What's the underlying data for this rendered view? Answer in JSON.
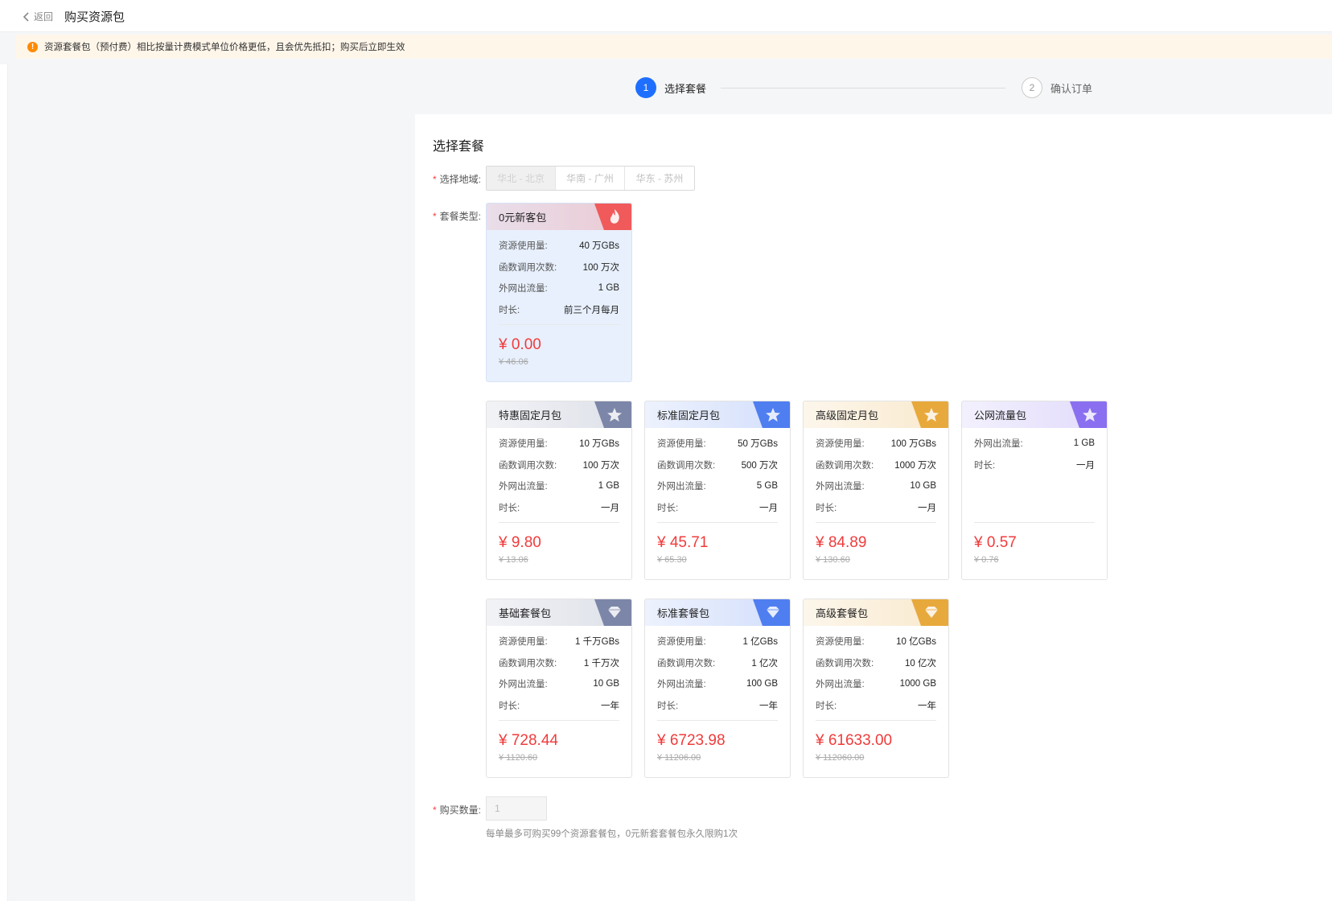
{
  "header": {
    "back_label": "返回",
    "title": "购买资源包"
  },
  "notice": {
    "text": "资源套餐包（预付费）相比按量计费模式单位价格更低，且会优先抵扣；购买后立即生效"
  },
  "steps": [
    {
      "num": "1",
      "label": "选择套餐",
      "active": true
    },
    {
      "num": "2",
      "label": "确认订单",
      "active": false
    }
  ],
  "panel": {
    "title": "选择套餐",
    "region_label": "选择地域:",
    "regions": [
      "华北 - 北京",
      "华南 - 广州",
      "华东 - 苏州"
    ],
    "selected_region": "华北 - 北京",
    "type_label": "套餐类型:",
    "quantity_label": "购买数量:",
    "quantity_value": "1",
    "hint": "每单最多可购买99个资源套餐包，0元新套套餐包永久限购1次"
  },
  "packages": [
    {
      "name": "0元新客包",
      "icon": "flame-icon",
      "accent": "#f05a5a",
      "selected": true,
      "rows": [
        {
          "k": "资源使用量:",
          "v": "40 万GBs"
        },
        {
          "k": "函数调用次数:",
          "v": "100 万次"
        },
        {
          "k": "外网出流量:",
          "v": "1 GB"
        },
        {
          "k": "时长:",
          "v": "前三个月每月"
        }
      ],
      "price": "¥ 0.00",
      "old_price": "¥ 46.06"
    },
    {
      "name": "特惠固定月包",
      "icon": "star-icon",
      "accent": "#7c86a8",
      "rows": [
        {
          "k": "资源使用量:",
          "v": "10 万GBs"
        },
        {
          "k": "函数调用次数:",
          "v": "100 万次"
        },
        {
          "k": "外网出流量:",
          "v": "1 GB"
        },
        {
          "k": "时长:",
          "v": "一月"
        }
      ],
      "price": "¥ 9.80",
      "old_price": "¥ 13.06"
    },
    {
      "name": "标准固定月包",
      "icon": "star-icon",
      "accent": "#4f7ef0",
      "rows": [
        {
          "k": "资源使用量:",
          "v": "50 万GBs"
        },
        {
          "k": "函数调用次数:",
          "v": "500 万次"
        },
        {
          "k": "外网出流量:",
          "v": "5 GB"
        },
        {
          "k": "时长:",
          "v": "一月"
        }
      ],
      "price": "¥ 45.71",
      "old_price": "¥ 65.30"
    },
    {
      "name": "高级固定月包",
      "icon": "star-icon",
      "accent": "#e8a93c",
      "rows": [
        {
          "k": "资源使用量:",
          "v": "100 万GBs"
        },
        {
          "k": "函数调用次数:",
          "v": "1000 万次"
        },
        {
          "k": "外网出流量:",
          "v": "10 GB"
        },
        {
          "k": "时长:",
          "v": "一月"
        }
      ],
      "price": "¥ 84.89",
      "old_price": "¥ 130.60"
    },
    {
      "name": "公网流量包",
      "icon": "star-icon",
      "accent": "#8a6ff0",
      "rows": [
        {
          "k": "外网出流量:",
          "v": "1 GB"
        },
        {
          "k": "时长:",
          "v": "一月"
        }
      ],
      "price": "¥ 0.57",
      "old_price": "¥ 0.76"
    },
    {
      "name": "基础套餐包",
      "icon": "diamond-icon",
      "accent": "#7c86a8",
      "rows": [
        {
          "k": "资源使用量:",
          "v": "1 千万GBs"
        },
        {
          "k": "函数调用次数:",
          "v": "1 千万次"
        },
        {
          "k": "外网出流量:",
          "v": "10 GB"
        },
        {
          "k": "时长:",
          "v": "一年"
        }
      ],
      "price": "¥ 728.44",
      "old_price": "¥ 1120.60"
    },
    {
      "name": "标准套餐包",
      "icon": "diamond-icon",
      "accent": "#4f7ef0",
      "rows": [
        {
          "k": "资源使用量:",
          "v": "1 亿GBs"
        },
        {
          "k": "函数调用次数:",
          "v": "1 亿次"
        },
        {
          "k": "外网出流量:",
          "v": "100 GB"
        },
        {
          "k": "时长:",
          "v": "一年"
        }
      ],
      "price": "¥ 6723.98",
      "old_price": "¥ 11206.00"
    },
    {
      "name": "高级套餐包",
      "icon": "diamond-icon",
      "accent": "#e8a93c",
      "rows": [
        {
          "k": "资源使用量:",
          "v": "10 亿GBs"
        },
        {
          "k": "函数调用次数:",
          "v": "10 亿次"
        },
        {
          "k": "外网出流量:",
          "v": "1000 GB"
        },
        {
          "k": "时长:",
          "v": "一年"
        }
      ],
      "price": "¥ 61633.00",
      "old_price": "¥ 112060.00"
    }
  ]
}
